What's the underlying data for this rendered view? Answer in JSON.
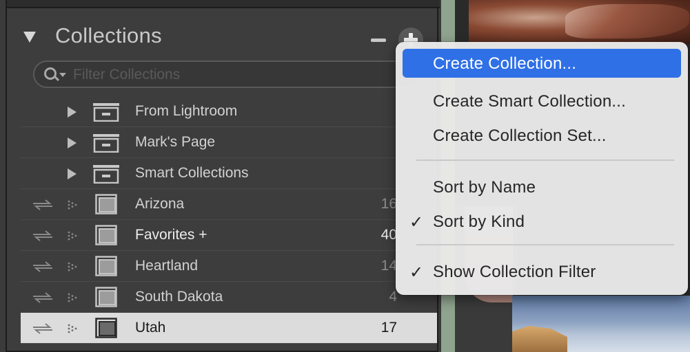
{
  "panel": {
    "title": "Collections",
    "filter_placeholder": "Filter Collections"
  },
  "collection_sets": [
    {
      "label": "From Lightroom"
    },
    {
      "label": "Mark's Page"
    },
    {
      "label": "Smart Collections"
    }
  ],
  "collections": [
    {
      "label": "Arizona",
      "count": "16"
    },
    {
      "label": "Favorites  +",
      "count": "40"
    },
    {
      "label": "Heartland",
      "count": "14"
    },
    {
      "label": "South Dakota",
      "count": "4"
    },
    {
      "label": "Utah",
      "count": "17"
    }
  ],
  "menu": {
    "items": [
      {
        "label": "Create Collection..."
      },
      {
        "label": "Create Smart Collection..."
      },
      {
        "label": "Create Collection Set..."
      },
      {
        "label": "Sort by Name"
      },
      {
        "label": "Sort by Kind",
        "check": "✓"
      },
      {
        "label": "Show Collection Filter",
        "check": "✓"
      }
    ]
  },
  "colors": {
    "menu_highlight": "#2f70e6",
    "panel_bg": "#3d3d3d",
    "selected_row": "#dcdcdc"
  }
}
